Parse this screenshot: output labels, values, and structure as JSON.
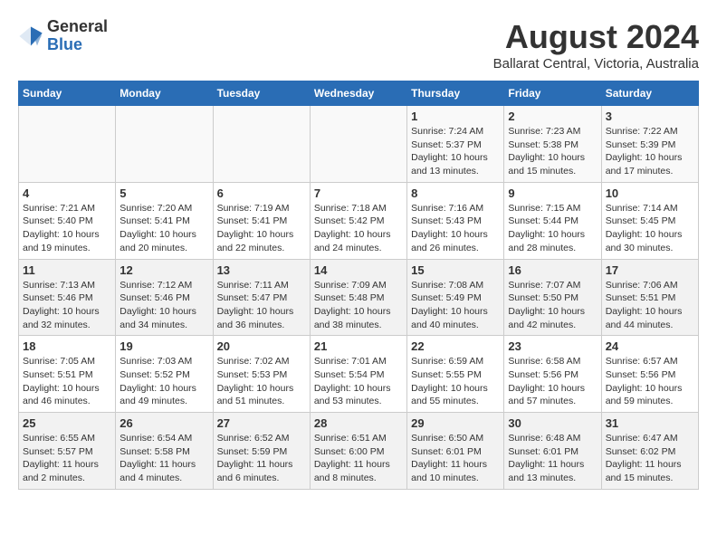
{
  "header": {
    "logo_general": "General",
    "logo_blue": "Blue",
    "month_title": "August 2024",
    "location": "Ballarat Central, Victoria, Australia"
  },
  "calendar": {
    "days_of_week": [
      "Sunday",
      "Monday",
      "Tuesday",
      "Wednesday",
      "Thursday",
      "Friday",
      "Saturday"
    ],
    "weeks": [
      [
        {
          "day": "",
          "info": ""
        },
        {
          "day": "",
          "info": ""
        },
        {
          "day": "",
          "info": ""
        },
        {
          "day": "",
          "info": ""
        },
        {
          "day": "1",
          "info": "Sunrise: 7:24 AM\nSunset: 5:37 PM\nDaylight: 10 hours\nand 13 minutes."
        },
        {
          "day": "2",
          "info": "Sunrise: 7:23 AM\nSunset: 5:38 PM\nDaylight: 10 hours\nand 15 minutes."
        },
        {
          "day": "3",
          "info": "Sunrise: 7:22 AM\nSunset: 5:39 PM\nDaylight: 10 hours\nand 17 minutes."
        }
      ],
      [
        {
          "day": "4",
          "info": "Sunrise: 7:21 AM\nSunset: 5:40 PM\nDaylight: 10 hours\nand 19 minutes."
        },
        {
          "day": "5",
          "info": "Sunrise: 7:20 AM\nSunset: 5:41 PM\nDaylight: 10 hours\nand 20 minutes."
        },
        {
          "day": "6",
          "info": "Sunrise: 7:19 AM\nSunset: 5:41 PM\nDaylight: 10 hours\nand 22 minutes."
        },
        {
          "day": "7",
          "info": "Sunrise: 7:18 AM\nSunset: 5:42 PM\nDaylight: 10 hours\nand 24 minutes."
        },
        {
          "day": "8",
          "info": "Sunrise: 7:16 AM\nSunset: 5:43 PM\nDaylight: 10 hours\nand 26 minutes."
        },
        {
          "day": "9",
          "info": "Sunrise: 7:15 AM\nSunset: 5:44 PM\nDaylight: 10 hours\nand 28 minutes."
        },
        {
          "day": "10",
          "info": "Sunrise: 7:14 AM\nSunset: 5:45 PM\nDaylight: 10 hours\nand 30 minutes."
        }
      ],
      [
        {
          "day": "11",
          "info": "Sunrise: 7:13 AM\nSunset: 5:46 PM\nDaylight: 10 hours\nand 32 minutes."
        },
        {
          "day": "12",
          "info": "Sunrise: 7:12 AM\nSunset: 5:46 PM\nDaylight: 10 hours\nand 34 minutes."
        },
        {
          "day": "13",
          "info": "Sunrise: 7:11 AM\nSunset: 5:47 PM\nDaylight: 10 hours\nand 36 minutes."
        },
        {
          "day": "14",
          "info": "Sunrise: 7:09 AM\nSunset: 5:48 PM\nDaylight: 10 hours\nand 38 minutes."
        },
        {
          "day": "15",
          "info": "Sunrise: 7:08 AM\nSunset: 5:49 PM\nDaylight: 10 hours\nand 40 minutes."
        },
        {
          "day": "16",
          "info": "Sunrise: 7:07 AM\nSunset: 5:50 PM\nDaylight: 10 hours\nand 42 minutes."
        },
        {
          "day": "17",
          "info": "Sunrise: 7:06 AM\nSunset: 5:51 PM\nDaylight: 10 hours\nand 44 minutes."
        }
      ],
      [
        {
          "day": "18",
          "info": "Sunrise: 7:05 AM\nSunset: 5:51 PM\nDaylight: 10 hours\nand 46 minutes."
        },
        {
          "day": "19",
          "info": "Sunrise: 7:03 AM\nSunset: 5:52 PM\nDaylight: 10 hours\nand 49 minutes."
        },
        {
          "day": "20",
          "info": "Sunrise: 7:02 AM\nSunset: 5:53 PM\nDaylight: 10 hours\nand 51 minutes."
        },
        {
          "day": "21",
          "info": "Sunrise: 7:01 AM\nSunset: 5:54 PM\nDaylight: 10 hours\nand 53 minutes."
        },
        {
          "day": "22",
          "info": "Sunrise: 6:59 AM\nSunset: 5:55 PM\nDaylight: 10 hours\nand 55 minutes."
        },
        {
          "day": "23",
          "info": "Sunrise: 6:58 AM\nSunset: 5:56 PM\nDaylight: 10 hours\nand 57 minutes."
        },
        {
          "day": "24",
          "info": "Sunrise: 6:57 AM\nSunset: 5:56 PM\nDaylight: 10 hours\nand 59 minutes."
        }
      ],
      [
        {
          "day": "25",
          "info": "Sunrise: 6:55 AM\nSunset: 5:57 PM\nDaylight: 11 hours\nand 2 minutes."
        },
        {
          "day": "26",
          "info": "Sunrise: 6:54 AM\nSunset: 5:58 PM\nDaylight: 11 hours\nand 4 minutes."
        },
        {
          "day": "27",
          "info": "Sunrise: 6:52 AM\nSunset: 5:59 PM\nDaylight: 11 hours\nand 6 minutes."
        },
        {
          "day": "28",
          "info": "Sunrise: 6:51 AM\nSunset: 6:00 PM\nDaylight: 11 hours\nand 8 minutes."
        },
        {
          "day": "29",
          "info": "Sunrise: 6:50 AM\nSunset: 6:01 PM\nDaylight: 11 hours\nand 10 minutes."
        },
        {
          "day": "30",
          "info": "Sunrise: 6:48 AM\nSunset: 6:01 PM\nDaylight: 11 hours\nand 13 minutes."
        },
        {
          "day": "31",
          "info": "Sunrise: 6:47 AM\nSunset: 6:02 PM\nDaylight: 11 hours\nand 15 minutes."
        }
      ]
    ]
  }
}
